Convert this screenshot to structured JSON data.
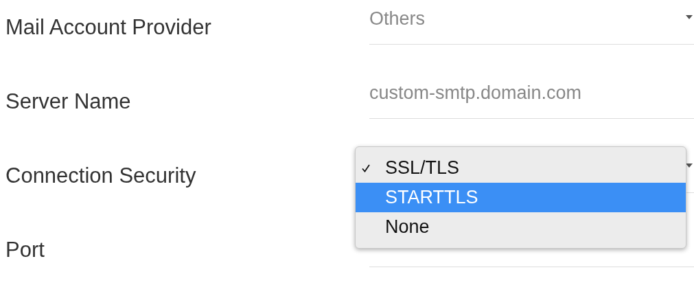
{
  "fields": [
    {
      "label": "Mail Account Provider",
      "kind": "select",
      "value": "Others"
    },
    {
      "label": "Server Name",
      "kind": "text",
      "value": "custom-smtp.domain.com"
    },
    {
      "label": "Connection Security",
      "kind": "select"
    },
    {
      "label": "Port",
      "kind": "text"
    }
  ],
  "security_menu": {
    "items": [
      {
        "label": "SSL/TLS",
        "checked": true,
        "selected": false
      },
      {
        "label": "STARTTLS",
        "checked": false,
        "selected": true
      },
      {
        "label": "None",
        "checked": false,
        "selected": false
      }
    ]
  }
}
